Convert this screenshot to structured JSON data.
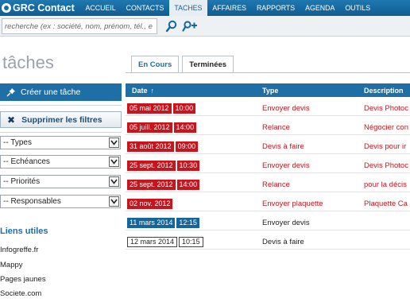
{
  "app": {
    "brand": "GRC Contact",
    "nav": [
      "ACCUEIL",
      "CONTACTS",
      "TACHES",
      "AFFAIRES",
      "RAPPORTS",
      "AGENDA",
      "OUTILS"
    ],
    "active_nav": "TACHES"
  },
  "search": {
    "placeholder": "recherche (ex : société, nom, prénom, tél., e"
  },
  "sidebar": {
    "title": "tâches",
    "create_label": "Créer une tâche",
    "clear_filters_label": "Supprimer les filtres",
    "filters": [
      "-- Types",
      "-- Echéances",
      "-- Priorités",
      "-- Responsables"
    ],
    "links_title": "Liens utiles",
    "links": [
      "Infogreffe.fr",
      "Mappy",
      "Pages jaunes",
      "Societe.com"
    ]
  },
  "tabs": [
    {
      "label": "En Cours",
      "active": true
    },
    {
      "label": "Terminées",
      "active": false
    }
  ],
  "table": {
    "headers": {
      "date": "Date",
      "type": "Type",
      "description": "Description"
    },
    "sort_indicator": "↑",
    "rows": [
      {
        "date": "05 mai 2012",
        "time": "10:00",
        "type": "Envoyer devis",
        "description": "Devis Photoc",
        "status": "overdue"
      },
      {
        "date": "05 juill. 2012",
        "time": "14:00",
        "type": "Relance",
        "description": "Négocier con",
        "status": "overdue"
      },
      {
        "date": "31 août 2012",
        "time": "09:00",
        "type": "Devis à faire",
        "description": "Devis pour ir",
        "status": "overdue"
      },
      {
        "date": "25 sept. 2012",
        "time": "10:30",
        "type": "Envoyer devis",
        "description": "Devis Photoc",
        "status": "overdue"
      },
      {
        "date": "25 sept. 2012",
        "time": "14:00",
        "type": "Relance",
        "description": "pour la décis",
        "status": "overdue"
      },
      {
        "date": "02 nov. 2012",
        "time": "",
        "type": "Envoyer plaquette",
        "description": "Plaquette Ca",
        "status": "overdue"
      },
      {
        "date": "11 mars 2014",
        "time": "12:15",
        "type": "Envoyer devis",
        "description": "",
        "status": "today"
      },
      {
        "date": "12 mars 2014",
        "time": "10:15",
        "type": "Devis à faire",
        "description": "",
        "status": "upcoming"
      }
    ]
  },
  "colors": {
    "brand_blue": "#1d6fa6",
    "overdue_red": "#c8141c",
    "today_blue": "#15659a"
  }
}
